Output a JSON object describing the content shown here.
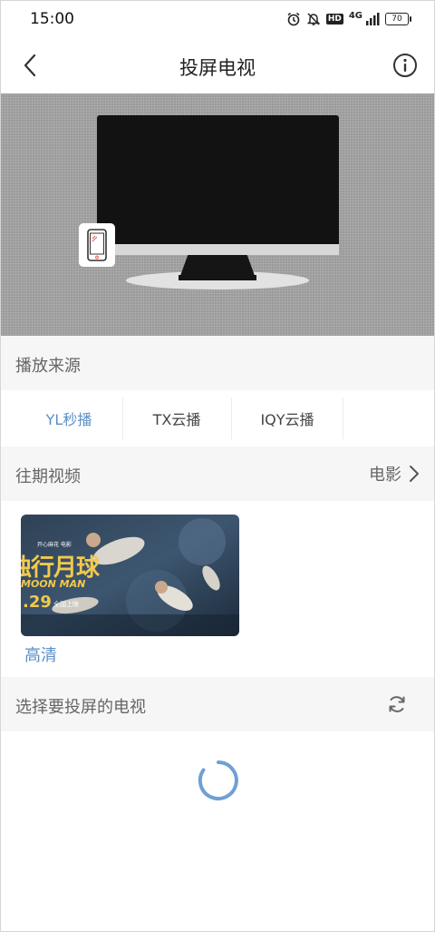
{
  "status_bar": {
    "time": "15:00",
    "network": "4G",
    "hd": "HD",
    "battery": "70"
  },
  "nav": {
    "title": "投屏电视"
  },
  "icons": {
    "back": "chevron-left-icon",
    "info": "info-icon",
    "refresh": "refresh-icon",
    "spinner": "loading-spinner-icon",
    "phone": "phone-icon"
  },
  "sections": {
    "source_title": "播放来源",
    "past_title": "往期视频",
    "past_category": "电影",
    "tv_title": "选择要投屏的电视"
  },
  "source_tabs": [
    {
      "label": "YL秒播",
      "active": true
    },
    {
      "label": "TX云播",
      "active": false
    },
    {
      "label": "IQY云播",
      "active": false
    }
  ],
  "video": {
    "poster_title": "独行月球",
    "poster_subtitle": "MOON MAN",
    "poster_date": ".29",
    "poster_release": "全国上映",
    "poster_tag": "开心麻花 电影",
    "quality": "高清"
  },
  "colors": {
    "accent": "#5b8fc7",
    "section_bg": "#f6f6f7"
  }
}
